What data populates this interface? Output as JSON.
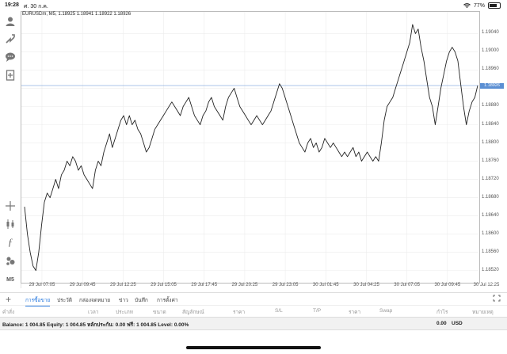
{
  "status_bar": {
    "time": "19:28",
    "date": "ศ. 30 ก.ค.",
    "battery": "77%",
    "battery_level": 0.77
  },
  "left_toolbar": {
    "timeframe_label": "M5"
  },
  "chart": {
    "symbol_line": "EURUSDm, M5, 1.18925 1.18941 1.18922 1.18926",
    "current_price": "1.18926",
    "colors": {
      "line": "#222222",
      "price_line": "#8fb0e0",
      "price_tag": "#5b8fd3"
    }
  },
  "chart_data": {
    "type": "line",
    "title": "EURUSDm, M5, 1.18925 1.18941 1.18922 1.18926",
    "xlabel": "",
    "ylabel": "",
    "ylim": [
      1.18495,
      1.19079
    ],
    "x_tick_labels": [
      "29 Jul 07:05",
      "29 Jul 09:45",
      "29 Jul 12:25",
      "29 Jul 15:05",
      "29 Jul 17:45",
      "29 Jul 20:25",
      "29 Jul 23:05",
      "30 Jul 01:45",
      "30 Jul 04:25",
      "30 Jul 07:05",
      "30 Jul 09:45",
      "30 Jul 12:25"
    ],
    "y_tick_labels": [
      "1.19040",
      "1.19000",
      "1.18960",
      "1.18920",
      "1.18880",
      "1.18840",
      "1.18800",
      "1.18760",
      "1.18720",
      "1.18680",
      "1.18640",
      "1.18600",
      "1.18560",
      "1.18520"
    ],
    "current_price_line": 1.18926,
    "series": [
      {
        "values": [
          1.1866,
          1.186,
          1.1856,
          1.1853,
          1.1852,
          1.1856,
          1.1862,
          1.1867,
          1.1869,
          1.1868,
          1.187,
          1.1872,
          1.187,
          1.1873,
          1.1874,
          1.1876,
          1.1875,
          1.1877,
          1.1876,
          1.1874,
          1.1875,
          1.1873,
          1.1872,
          1.1871,
          1.187,
          1.1874,
          1.1876,
          1.1875,
          1.1878,
          1.188,
          1.1882,
          1.1879,
          1.1881,
          1.1883,
          1.1885,
          1.1886,
          1.1884,
          1.1886,
          1.1884,
          1.1885,
          1.1883,
          1.1882,
          1.188,
          1.1878,
          1.1879,
          1.1881,
          1.1883,
          1.1884,
          1.1885,
          1.1886,
          1.1887,
          1.1888,
          1.1889,
          1.1888,
          1.1887,
          1.1886,
          1.1888,
          1.1889,
          1.189,
          1.1888,
          1.1886,
          1.1885,
          1.1884,
          1.1886,
          1.1887,
          1.1889,
          1.189,
          1.1888,
          1.1887,
          1.1886,
          1.1885,
          1.1888,
          1.189,
          1.1891,
          1.1892,
          1.189,
          1.1888,
          1.1887,
          1.1886,
          1.1885,
          1.1884,
          1.1885,
          1.1886,
          1.1885,
          1.1884,
          1.1885,
          1.1886,
          1.1887,
          1.1889,
          1.1891,
          1.1893,
          1.1892,
          1.189,
          1.1888,
          1.1886,
          1.1884,
          1.1882,
          1.188,
          1.1879,
          1.1878,
          1.188,
          1.1881,
          1.1879,
          1.188,
          1.1878,
          1.1879,
          1.1881,
          1.188,
          1.1879,
          1.188,
          1.1879,
          1.1878,
          1.1877,
          1.1878,
          1.1877,
          1.1878,
          1.1879,
          1.1877,
          1.1878,
          1.1876,
          1.1877,
          1.1878,
          1.1877,
          1.1876,
          1.1877,
          1.1876,
          1.188,
          1.1885,
          1.1888,
          1.1889,
          1.189,
          1.1892,
          1.1894,
          1.1896,
          1.1898,
          1.19,
          1.1902,
          1.1906,
          1.1904,
          1.1905,
          1.1901,
          1.1898,
          1.1894,
          1.189,
          1.1888,
          1.1884,
          1.1888,
          1.1892,
          1.1895,
          1.1898,
          1.19,
          1.1901,
          1.19,
          1.1898,
          1.1893,
          1.1888,
          1.1884,
          1.1887,
          1.1889,
          1.189,
          1.18926
        ]
      }
    ]
  },
  "bottom_panel": {
    "tabs": [
      "การซื้อขาย",
      "ประวัติ",
      "กล่องจดหมาย",
      "ข่าว",
      "บันทึก",
      "การตั้งค่า"
    ],
    "columns": [
      "คำสั่ง",
      "เวลา",
      "ประเภท",
      "ขนาด",
      "สัญลักษณ์",
      "ราคา",
      "S/L",
      "T/P",
      "ราคา",
      "Swap",
      "กำไร",
      "หมายเหตุ"
    ],
    "balance_line": "Balance: 1 004.85 Equity: 1 004.85 หลักประกัน: 0.00 ฟรี: 1 004.85 Level: 0.00%",
    "profit_total": "0.00",
    "currency": "USD"
  }
}
